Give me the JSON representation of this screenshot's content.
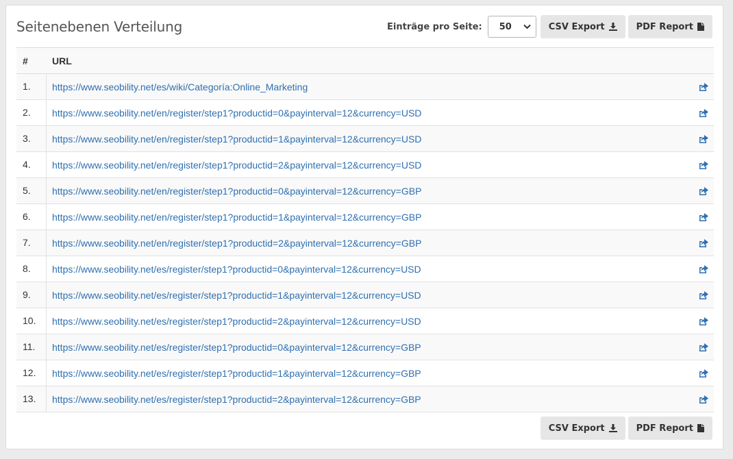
{
  "title": "Seitenebenen Verteilung",
  "toolbar": {
    "per_page_label": "Einträge pro Seite:",
    "per_page_value": "50",
    "csv_label": "CSV Export",
    "pdf_label": "PDF Report"
  },
  "table": {
    "headers": [
      "#",
      "URL"
    ],
    "rows": [
      {
        "num": "1.",
        "url": "https://www.seobility.net/es/wiki/Categoría:Online_Marketing"
      },
      {
        "num": "2.",
        "url": "https://www.seobility.net/en/register/step1?productid=0&payinterval=12&currency=USD"
      },
      {
        "num": "3.",
        "url": "https://www.seobility.net/en/register/step1?productid=1&payinterval=12&currency=USD"
      },
      {
        "num": "4.",
        "url": "https://www.seobility.net/en/register/step1?productid=2&payinterval=12&currency=USD"
      },
      {
        "num": "5.",
        "url": "https://www.seobility.net/en/register/step1?productid=0&payinterval=12&currency=GBP"
      },
      {
        "num": "6.",
        "url": "https://www.seobility.net/en/register/step1?productid=1&payinterval=12&currency=GBP"
      },
      {
        "num": "7.",
        "url": "https://www.seobility.net/en/register/step1?productid=2&payinterval=12&currency=GBP"
      },
      {
        "num": "8.",
        "url": "https://www.seobility.net/es/register/step1?productid=0&payinterval=12&currency=USD"
      },
      {
        "num": "9.",
        "url": "https://www.seobility.net/es/register/step1?productid=1&payinterval=12&currency=USD"
      },
      {
        "num": "10.",
        "url": "https://www.seobility.net/es/register/step1?productid=2&payinterval=12&currency=USD"
      },
      {
        "num": "11.",
        "url": "https://www.seobility.net/es/register/step1?productid=0&payinterval=12&currency=GBP"
      },
      {
        "num": "12.",
        "url": "https://www.seobility.net/es/register/step1?productid=1&payinterval=12&currency=GBP"
      },
      {
        "num": "13.",
        "url": "https://www.seobility.net/es/register/step1?productid=2&payinterval=12&currency=GBP"
      }
    ]
  },
  "icons": {
    "row_action": "external-link-icon",
    "csv": "download-icon",
    "pdf": "file-icon",
    "select": "chevron-down-icon"
  },
  "colors": {
    "link": "#2e6fb0",
    "button_bg": "#e6e6e6",
    "page_bg": "#ebebeb"
  }
}
